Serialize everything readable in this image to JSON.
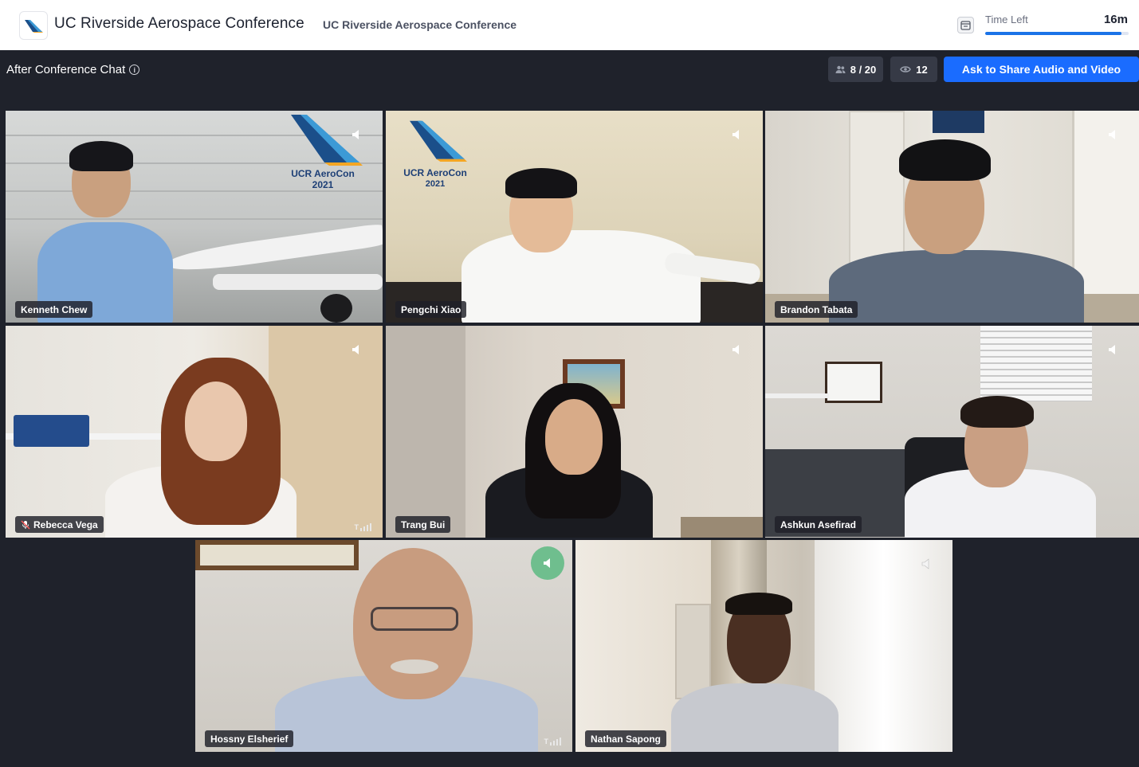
{
  "header": {
    "app_title": "UC Riverside Aerospace Conference",
    "subtitle": "UC Riverside Aerospace Conference",
    "logo_icon": "aerocon-tail-logo-icon",
    "calendar_icon": "calendar-icon",
    "timer": {
      "label": "Time Left",
      "value": "16m",
      "progress_fraction": 0.95,
      "accent": "#1a73e8"
    }
  },
  "room": {
    "title": "After Conference Chat",
    "info_icon": "info-icon",
    "participants": {
      "icon": "people-icon",
      "text": "8 / 20"
    },
    "viewers": {
      "icon": "eye-icon",
      "text": "12"
    },
    "share_button": {
      "label": "Ask to Share Audio and Video",
      "color": "#1a6cff"
    }
  },
  "watermark": {
    "line1": "UCR AeroCon",
    "line2": "2021"
  },
  "participants": [
    {
      "name": "Kenneth Chew",
      "speaker_icon": "speaker-icon"
    },
    {
      "name": "Pengchi Xiao",
      "speaker_icon": "speaker-icon"
    },
    {
      "name": "Brandon Tabata",
      "speaker_icon": "speaker-icon"
    },
    {
      "name": "Rebecca Vega",
      "speaker_icon": "speaker-icon",
      "muted_icon": "mic-muted-icon",
      "signal_icon": "signal-strength-icon"
    },
    {
      "name": "Trang Bui",
      "speaker_icon": "speaker-icon"
    },
    {
      "name": "Ashkun Asefirad",
      "speaker_icon": "speaker-icon"
    },
    {
      "name": "Hossny Elsherief",
      "speaker_icon": "speaker-active-icon",
      "signal_icon": "signal-strength-icon"
    },
    {
      "name": "Nathan Sapong",
      "speaker_icon": "speaker-icon"
    }
  ]
}
